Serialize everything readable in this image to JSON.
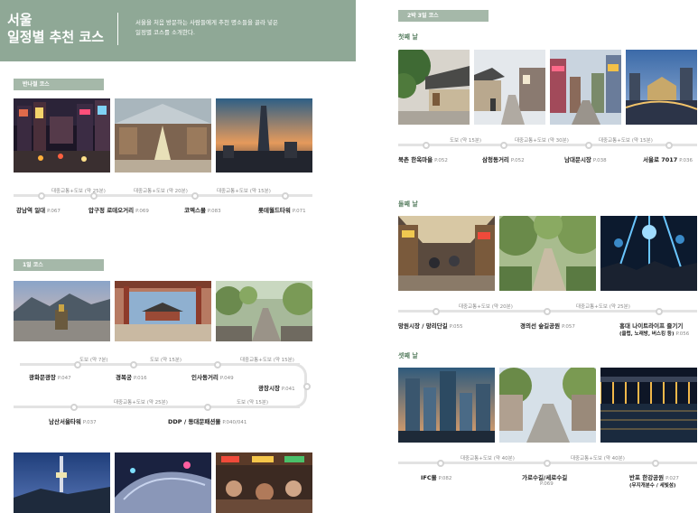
{
  "header": {
    "title_line1": "서울",
    "title_line2": "일정별 추천 코스",
    "desc_line1": "서울을 처음 방문하는 사람들에게 추천 명소들을 골라 넣은",
    "desc_line2": "일정별 코스를 소개한다."
  },
  "half_day": {
    "tag": "반나절 코스",
    "legs": [
      "대중교통+도보 (약 25분)",
      "대중교통+도보 (약 20분)",
      "대중교통+도보 (약 15분)"
    ],
    "stops": [
      {
        "name": "강남역 일대",
        "page": "P.067"
      },
      {
        "name": "압구정 로데오거리",
        "page": "P.069"
      },
      {
        "name": "코엑스몰",
        "page": "P.083"
      },
      {
        "name": "롯데월드타워",
        "page": "P.071"
      }
    ]
  },
  "one_day": {
    "tag": "1일 코스",
    "legs_row1": [
      "도보 (약 7분)",
      "도보 (약 15분)",
      "대중교통+도보 (약 15분)"
    ],
    "legs_row2": [
      "대중교통+도보 (약 25분)",
      "도보 (약 15분)"
    ],
    "stops_row1": [
      {
        "name": "광화문광장",
        "page": "P.047"
      },
      {
        "name": "경복궁",
        "page": "P.016"
      },
      {
        "name": "인사동거리",
        "page": "P.049"
      },
      {
        "name": "광장시장",
        "page": "P.041"
      }
    ],
    "stops_row2": [
      {
        "name": "남산서울타워",
        "page": "P.037"
      },
      {
        "name": "DDP / 동대문패션몰",
        "page": "P.040/041"
      }
    ]
  },
  "multi_day": {
    "tag": "2박 3일 코스",
    "day1": {
      "label": "첫째 날",
      "legs": [
        "도보 (약 15분)",
        "대중교통+도보 (약 30분)",
        "대중교통+도보 (약 15분)"
      ],
      "stops": [
        {
          "name": "북촌 한옥마을",
          "page": "P.052"
        },
        {
          "name": "삼청동거리",
          "page": "P.052"
        },
        {
          "name": "남대문시장",
          "page": "P.038"
        },
        {
          "name": "서울로 7017",
          "page": "P.036"
        }
      ]
    },
    "day2": {
      "label": "둘째 날",
      "legs": [
        "대중교통+도보 (약 20분)",
        "대중교통+도보 (약 25분)"
      ],
      "stops": [
        {
          "name": "망원시장 / 망리단길",
          "page": "P.055"
        },
        {
          "name": "경의선 숲길공원",
          "page": "P.057"
        },
        {
          "name": "홍대 나이트라이프 즐기기",
          "sub": "(클럽, 노래방, 버스킹 등)",
          "page": "P.056"
        }
      ]
    },
    "day3": {
      "label": "셋째 날",
      "legs": [
        "대중교통+도보 (약 40분)",
        "대중교통+도보 (약 40분)"
      ],
      "stops": [
        {
          "name": "IFC몰",
          "page": "P.082"
        },
        {
          "name": "가로수길/세로수길",
          "page": "P.069"
        },
        {
          "name": "반포 한강공원",
          "sub": "(무지개분수 / 세빛섬)",
          "page": "P.027"
        }
      ]
    }
  },
  "colors": {
    "header_bg": "#8fa896",
    "tag_bg": "#a5b8a9",
    "day_label": "#5a8063",
    "route_line": "#e3e3e3"
  }
}
